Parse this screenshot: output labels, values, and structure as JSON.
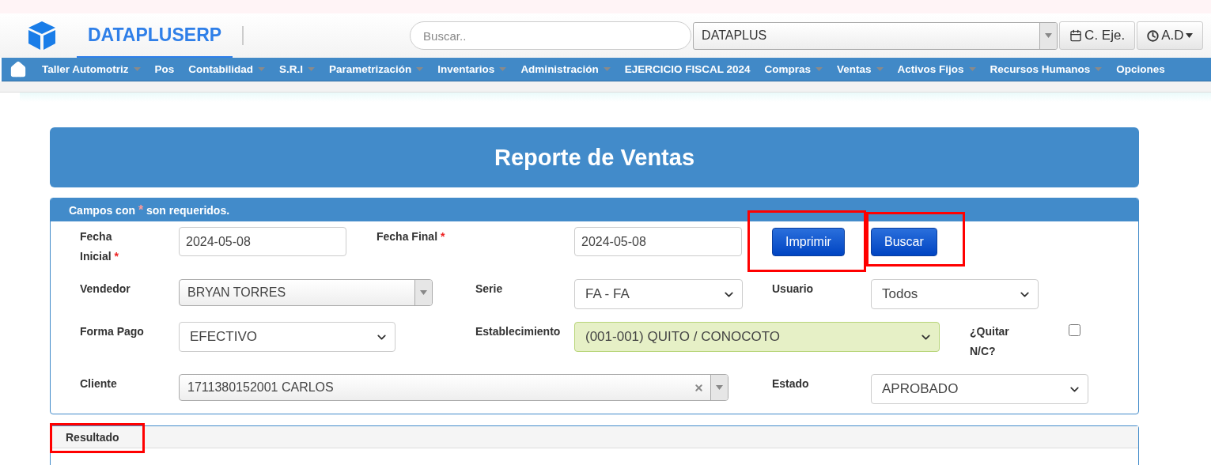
{
  "header": {
    "brand": "DATAPLUSERP",
    "search": {
      "placeholder": "Buscar.."
    },
    "company": {
      "value": "DATAPLUS"
    },
    "buttons": [
      {
        "label": "C. Eje.",
        "caret": false
      },
      {
        "label": "A.D",
        "caret": true
      }
    ]
  },
  "nav": [
    {
      "label": "Taller Automotriz",
      "dropdown": true
    },
    {
      "label": "Pos",
      "dropdown": false
    },
    {
      "label": "Contabilidad",
      "dropdown": true
    },
    {
      "label": "S.R.I",
      "dropdown": true
    },
    {
      "label": "Parametrización",
      "dropdown": true
    },
    {
      "label": "Inventarios",
      "dropdown": true
    },
    {
      "label": "Administración",
      "dropdown": true
    },
    {
      "label": "EJERCICIO FISCAL 2024",
      "dropdown": false
    },
    {
      "label": "Compras",
      "dropdown": true
    },
    {
      "label": "Ventas",
      "dropdown": true
    },
    {
      "label": "Activos Fijos",
      "dropdown": true
    },
    {
      "label": "Recursos Humanos",
      "dropdown": true
    },
    {
      "label": "Opciones",
      "dropdown": false
    }
  ],
  "title": "Reporte de Ventas",
  "form": {
    "note": {
      "before": "Campos con",
      "mark": "*",
      "after": "son requeridos."
    },
    "fields": [
      {
        "label": "Fecha Inicial",
        "required_mark": "*",
        "kind": "date",
        "value": "2024-05-08"
      },
      {
        "label": "Fecha Final",
        "required_mark": "*",
        "kind": "date",
        "value": "2024-05-08"
      },
      {
        "label": "Vendedor",
        "kind": "combo",
        "value": "BRYAN TORRES",
        "clearable": false
      },
      {
        "label": "Serie",
        "kind": "select",
        "value": "FA - FA",
        "validated": false
      },
      {
        "label": "Usuario",
        "kind": "select",
        "value": "Todos",
        "validated": false
      },
      {
        "label": "Forma Pago",
        "kind": "select",
        "value": "EFECTIVO",
        "validated": false
      },
      {
        "label": "Establecimiento",
        "kind": "select",
        "value": "(001-001) QUITO / CONOCOTO",
        "validated": true
      },
      {
        "label": "¿Quitar N/C?",
        "kind": "checkbox",
        "checked": false
      },
      {
        "label": "Cliente",
        "kind": "combo",
        "value": "1711380152001 CARLOS",
        "clearable": true
      },
      {
        "label": "Estado",
        "kind": "select",
        "value": "APROBADO",
        "validated": false
      }
    ],
    "actions": [
      {
        "label": "Imprimir",
        "highlighted": true
      },
      {
        "label": "Buscar",
        "highlighted": true
      }
    ]
  },
  "result": {
    "title": "Resultado",
    "highlighted": true
  }
}
